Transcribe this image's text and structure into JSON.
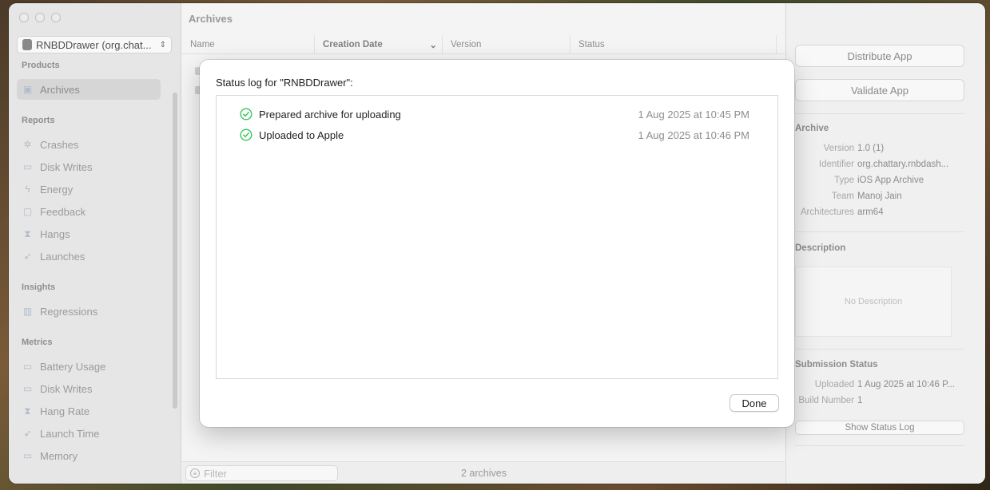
{
  "window": {
    "sidebar": {
      "app_selector": "RNBDDrawer (org.chat...",
      "sections": {
        "products": "Products",
        "reports": "Reports",
        "insights": "Insights",
        "metrics": "Metrics"
      },
      "products": [
        {
          "label": "Archives",
          "icon": "archive-icon"
        }
      ],
      "reports": [
        {
          "label": "Crashes",
          "icon": "crash-icon"
        },
        {
          "label": "Disk Writes",
          "icon": "disk-icon"
        },
        {
          "label": "Energy",
          "icon": "bolt-icon"
        },
        {
          "label": "Feedback",
          "icon": "chat-bubble-icon"
        },
        {
          "label": "Hangs",
          "icon": "hourglass-icon"
        },
        {
          "label": "Launches",
          "icon": "rocket-icon"
        }
      ],
      "insights": [
        {
          "label": "Regressions",
          "icon": "bar-chart-icon"
        }
      ],
      "metrics": [
        {
          "label": "Battery Usage",
          "icon": "battery-icon"
        },
        {
          "label": "Disk Writes",
          "icon": "disk-icon"
        },
        {
          "label": "Hang Rate",
          "icon": "hourglass-icon"
        },
        {
          "label": "Launch Time",
          "icon": "rocket-icon"
        },
        {
          "label": "Memory",
          "icon": "memory-icon"
        }
      ]
    },
    "main": {
      "title": "Archives",
      "columns": [
        "Name",
        "Creation Date",
        "Version",
        "Status"
      ],
      "filter_placeholder": "Filter",
      "archive_count": "2 archives"
    },
    "inspector": {
      "distribute_button": "Distribute App",
      "validate_button": "Validate App",
      "archive_section": "Archive",
      "archive_fields": [
        {
          "key": "Version",
          "value": "1.0 (1)"
        },
        {
          "key": "Identifier",
          "value": "org.chattary.rnbdash..."
        },
        {
          "key": "Type",
          "value": "iOS App Archive"
        },
        {
          "key": "Team",
          "value": "Manoj Jain"
        },
        {
          "key": "Architectures",
          "value": "arm64"
        }
      ],
      "description_section": "Description",
      "description_placeholder": "No Description",
      "submission_section": "Submission Status",
      "submission_fields": [
        {
          "key": "Uploaded",
          "value": "1 Aug 2025 at 10:46 P..."
        },
        {
          "key": "Build Number",
          "value": "1"
        }
      ],
      "status_log_button": "Show Status Log"
    }
  },
  "dialog": {
    "title": "Status log for \"RNBDDrawer\":",
    "entries": [
      {
        "text": "Prepared archive for uploading",
        "time": "1 Aug 2025 at 10:45 PM",
        "status": "success"
      },
      {
        "text": "Uploaded to Apple",
        "time": "1 Aug 2025 at 10:46 PM",
        "status": "success"
      }
    ],
    "done_button": "Done",
    "success_color": "#34c759"
  }
}
